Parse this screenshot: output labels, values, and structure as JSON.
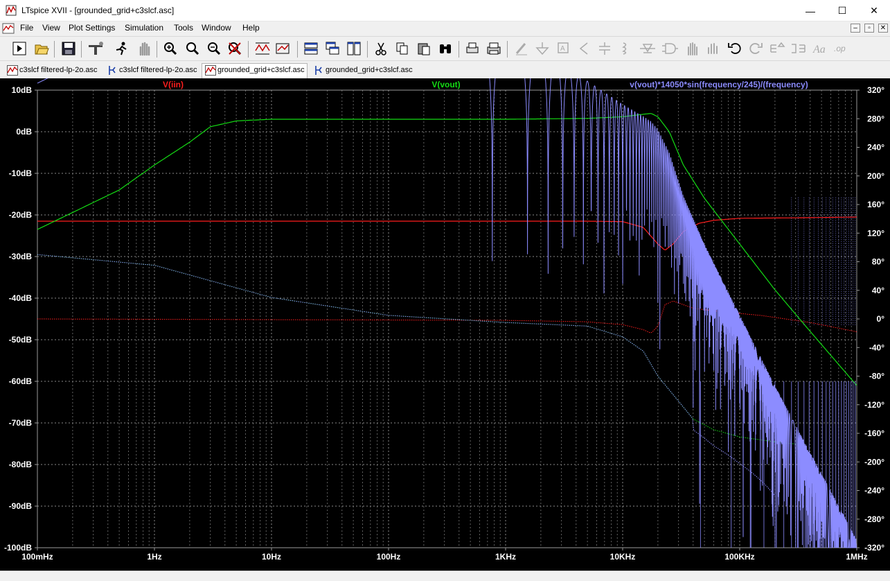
{
  "window": {
    "title": "LTspice XVII - [grounded_grid+c3slcf.asc]",
    "minimize_glyph": "—",
    "maximize_glyph": "☐",
    "close_glyph": "✕"
  },
  "menu": [
    "File",
    "View",
    "Plot Settings",
    "Simulation",
    "Tools",
    "Window",
    "Help"
  ],
  "mdi_controls": [
    "–",
    "▫",
    "✕"
  ],
  "toolbar": {
    "buttons": [
      "run-icon",
      "open-icon",
      "save-icon",
      "control-panel-icon",
      "halt-icon",
      "pan-icon",
      "zoom-in-icon",
      "zoom-full-icon",
      "zoom-out-icon",
      "zoom-cancel-icon",
      "autorange-icon",
      "pick-visible-traces-icon",
      "tile-horizontal-icon",
      "cascade-icon",
      "tile-icon",
      "cut-icon",
      "copy-icon",
      "paste-icon",
      "find-icon",
      "print-preview-icon",
      "print-icon",
      "draw-wire-icon",
      "ground-icon",
      "label-net-icon",
      "resistor-icon",
      "capacitor-icon",
      "inductor-icon",
      "diode-icon",
      "component-icon",
      "move-icon",
      "drag-icon",
      "undo-icon",
      "redo-icon",
      "rotate-icon",
      "mirror-icon",
      "text-icon",
      "spice-directive-icon"
    ]
  },
  "tabs": [
    {
      "label": "c3slcf filtered-lp-2o.asc",
      "kind": "waveform",
      "active": false
    },
    {
      "label": "c3slcf filtered-lp-2o.asc",
      "kind": "schematic",
      "active": false
    },
    {
      "label": "grounded_grid+c3slcf.asc",
      "kind": "waveform",
      "active": true
    },
    {
      "label": "grounded_grid+c3slcf.asc",
      "kind": "schematic",
      "active": false
    }
  ],
  "colors": {
    "background": "#000000",
    "grid": "#8a8a8a",
    "axis_text": "#ffffff",
    "iin": "#ff1e1e",
    "vout": "#14dc14",
    "expr": "#8c8cff"
  },
  "chart_data": {
    "type": "line",
    "x_scale": "log",
    "xlim_hz": [
      0.1,
      1000000
    ],
    "x_ticks": [
      "100mHz",
      "1Hz",
      "10Hz",
      "100Hz",
      "1KHz",
      "10KHz",
      "100KHz",
      "1MHz"
    ],
    "y_left_ticks": [
      "10dB",
      "0dB",
      "-10dB",
      "-20dB",
      "-30dB",
      "-40dB",
      "-50dB",
      "-60dB",
      "-70dB",
      "-80dB",
      "-90dB",
      "-100dB"
    ],
    "y_left_range_db": [
      -100,
      10
    ],
    "y_right_ticks": [
      "320°",
      "280°",
      "240°",
      "200°",
      "160°",
      "120°",
      "80°",
      "40°",
      "0°",
      "-40°",
      "-80°",
      "-120°",
      "-160°",
      "-200°",
      "-240°",
      "-280°",
      "-320°"
    ],
    "y_right_range_deg": [
      -320,
      320
    ],
    "grid": true,
    "series": [
      {
        "name": "V(iin)",
        "color": "#ff1e1e",
        "magnitude_db": [
          [
            0.1,
            -21.5
          ],
          [
            100,
            -21.5
          ],
          [
            5000,
            -21.5
          ],
          [
            10000,
            -21.6
          ],
          [
            15000,
            -23
          ],
          [
            20000,
            -27
          ],
          [
            23000,
            -28.5
          ],
          [
            27000,
            -27
          ],
          [
            33000,
            -24
          ],
          [
            45000,
            -22
          ],
          [
            60000,
            -21.3
          ],
          [
            100000,
            -20.8
          ],
          [
            300000,
            -20.7
          ],
          [
            1000000,
            -20.5
          ]
        ],
        "phase_deg": [
          [
            0.1,
            0
          ],
          [
            1000,
            -2
          ],
          [
            5000,
            -4
          ],
          [
            10000,
            -8
          ],
          [
            15000,
            -15
          ],
          [
            17500,
            -20
          ],
          [
            20000,
            -10
          ],
          [
            23000,
            20
          ],
          [
            27000,
            25
          ],
          [
            40000,
            15
          ],
          [
            70000,
            10
          ],
          [
            150000,
            5
          ],
          [
            400000,
            -5
          ],
          [
            1000000,
            -18
          ]
        ]
      },
      {
        "name": "V(vout)",
        "color": "#14dc14",
        "magnitude_db": [
          [
            0.1,
            -23.5
          ],
          [
            0.5,
            -14
          ],
          [
            1,
            -8
          ],
          [
            2,
            -2.5
          ],
          [
            3,
            1.2
          ],
          [
            5,
            2.6
          ],
          [
            10,
            3
          ],
          [
            100,
            3
          ],
          [
            1000,
            3
          ],
          [
            5000,
            3.2
          ],
          [
            10000,
            3.6
          ],
          [
            15000,
            4.2
          ],
          [
            17500,
            4.4
          ],
          [
            20000,
            3.6
          ],
          [
            25000,
            0
          ],
          [
            33000,
            -8
          ],
          [
            50000,
            -16
          ],
          [
            100000,
            -27
          ],
          [
            200000,
            -38
          ],
          [
            400000,
            -48
          ],
          [
            1000000,
            -61
          ]
        ],
        "phase_deg": [
          [
            0.1,
            90
          ],
          [
            1,
            75
          ],
          [
            10,
            30
          ],
          [
            100,
            5
          ],
          [
            1000,
            -5
          ],
          [
            5000,
            -10
          ],
          [
            10000,
            -25
          ],
          [
            15000,
            -45
          ],
          [
            20000,
            -80
          ],
          [
            30000,
            -115
          ],
          [
            40000,
            -140
          ],
          [
            60000,
            -155
          ],
          [
            100000,
            -165
          ],
          [
            200000,
            -172
          ],
          [
            300000,
            -175
          ]
        ]
      },
      {
        "name": "v(vout)*14050*sin(frequency/245)/(frequency)",
        "color": "#8c8cff",
        "notch_freqs_hz": [
          46250,
          84550,
          123000,
          161000,
          200000,
          238000,
          277000,
          316000,
          354000,
          392000,
          431000,
          470000,
          508000,
          547000,
          585000,
          623000,
          662000,
          700000,
          739000,
          778000,
          816000,
          855000,
          893000,
          931000,
          970000
        ]
      }
    ]
  }
}
